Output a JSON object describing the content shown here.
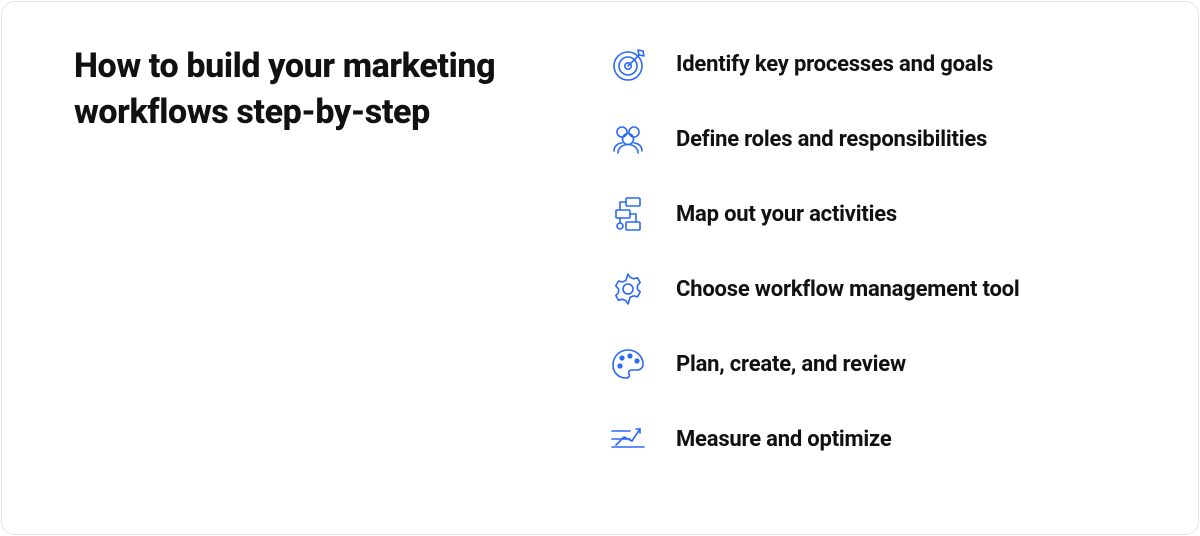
{
  "title": "How to build your marketing workflows step-by-step",
  "steps": [
    {
      "icon": "target-icon",
      "label": "Identify key processes and goals"
    },
    {
      "icon": "people-icon",
      "label": "Define roles and responsibilities"
    },
    {
      "icon": "flow-icon",
      "label": "Map out your activities"
    },
    {
      "icon": "gear-icon",
      "label": "Choose workflow management tool"
    },
    {
      "icon": "palette-icon",
      "label": "Plan, create, and review"
    },
    {
      "icon": "chart-icon",
      "label": "Measure and optimize"
    }
  ],
  "colors": {
    "accent": "#2b69f5"
  }
}
